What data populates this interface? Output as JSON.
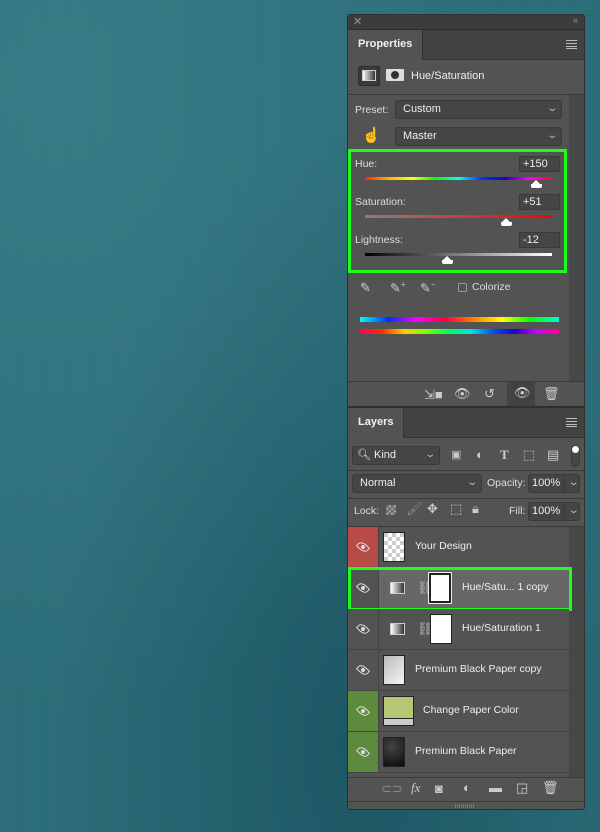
{
  "properties_panel": {
    "close_glyph": "✕",
    "collapse_glyph": "‹‹",
    "tab_label": "Properties",
    "adjustment_title": "Hue/Saturation",
    "preset_label": "Preset:",
    "preset_value": "Custom",
    "channel_value": "Master",
    "sliders": [
      {
        "label": "Hue:",
        "value": "+150",
        "min": -180,
        "max": 180,
        "numeric": 150
      },
      {
        "label": "Saturation:",
        "value": "+51",
        "min": -100,
        "max": 100,
        "numeric": 51
      },
      {
        "label": "Lightness:",
        "value": "-12",
        "min": -100,
        "max": 100,
        "numeric": -12
      }
    ],
    "colorize_label": "Colorize",
    "colorize_checked": false,
    "highlight_color": "#1cff1c"
  },
  "layers_panel": {
    "tab_label": "Layers",
    "filter_kind": "Kind",
    "blend_mode": "Normal",
    "opacity_label": "Opacity:",
    "opacity_value": "100%",
    "lock_label": "Lock:",
    "fill_label": "Fill:",
    "fill_value": "100%",
    "layers": [
      {
        "name": "Your Design",
        "type": "pixel",
        "eye_color": "#b84b46",
        "thumb": "transparent"
      },
      {
        "name": "Hue/Satu... 1 copy",
        "type": "adjustment",
        "selected": true,
        "thumb": "mask"
      },
      {
        "name": "Hue/Saturation 1",
        "type": "adjustment",
        "thumb": "mask"
      },
      {
        "name": "Premium Black Paper copy",
        "type": "pixel",
        "thumb": "light-gradient"
      },
      {
        "name": "Change Paper Color",
        "type": "fill",
        "eye_color": "#5d8a3c",
        "thumb": "color-fill",
        "fill_color": "#b5c775"
      },
      {
        "name": "Premium Black Paper",
        "type": "pixel",
        "eye_color": "#5d8a3c",
        "thumb": "dark-gradient"
      }
    ]
  }
}
